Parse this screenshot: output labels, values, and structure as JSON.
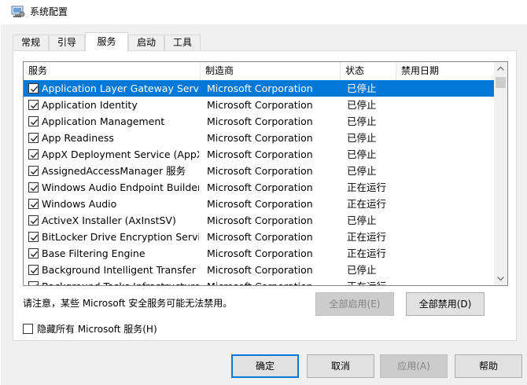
{
  "window": {
    "title": "系统配置",
    "icon": "msconfig-icon"
  },
  "tabs": [
    {
      "label": "常规",
      "active": false
    },
    {
      "label": "引导",
      "active": false
    },
    {
      "label": "服务",
      "active": true
    },
    {
      "label": "启动",
      "active": false
    },
    {
      "label": "工具",
      "active": false
    }
  ],
  "services": {
    "columns": [
      "服务",
      "制造商",
      "状态",
      "禁用日期"
    ],
    "rows": [
      {
        "name": "Application Layer Gateway Service",
        "vendor": "Microsoft Corporation",
        "status": "已停止",
        "date": "",
        "checked": true,
        "selected": true
      },
      {
        "name": "Application Identity",
        "vendor": "Microsoft Corporation",
        "status": "已停止",
        "date": "",
        "checked": true
      },
      {
        "name": "Application Management",
        "vendor": "Microsoft Corporation",
        "status": "已停止",
        "date": "",
        "checked": true
      },
      {
        "name": "App Readiness",
        "vendor": "Microsoft Corporation",
        "status": "已停止",
        "date": "",
        "checked": true
      },
      {
        "name": "AppX Deployment Service (AppX...",
        "vendor": "Microsoft Corporation",
        "status": "已停止",
        "date": "",
        "checked": true
      },
      {
        "name": "AssignedAccessManager 服务",
        "vendor": "Microsoft Corporation",
        "status": "已停止",
        "date": "",
        "checked": true
      },
      {
        "name": "Windows Audio Endpoint Builder",
        "vendor": "Microsoft Corporation",
        "status": "正在运行",
        "date": "",
        "checked": true
      },
      {
        "name": "Windows Audio",
        "vendor": "Microsoft Corporation",
        "status": "正在运行",
        "date": "",
        "checked": true
      },
      {
        "name": "ActiveX Installer (AxInstSV)",
        "vendor": "Microsoft Corporation",
        "status": "已停止",
        "date": "",
        "checked": true
      },
      {
        "name": "BitLocker Drive Encryption Service",
        "vendor": "Microsoft Corporation",
        "status": "正在运行",
        "date": "",
        "checked": true
      },
      {
        "name": "Base Filtering Engine",
        "vendor": "Microsoft Corporation",
        "status": "正在运行",
        "date": "",
        "checked": true
      },
      {
        "name": "Background Intelligent Transfer ...",
        "vendor": "Microsoft Corporation",
        "status": "已停止",
        "date": "",
        "checked": true
      },
      {
        "name": "Background Tasks Infrastructure ...",
        "vendor": "Microsoft Corporation",
        "status": "正在运行",
        "date": "",
        "checked": true
      }
    ]
  },
  "note": "请注意，某些 Microsoft 安全服务可能无法禁用。",
  "buttons": {
    "enable_all": "全部启用(E)",
    "disable_all": "全部禁用(D)",
    "ok": "确定",
    "cancel": "取消",
    "apply": "应用(A)",
    "help": "帮助"
  },
  "hide_ms": {
    "label": "隐藏所有 Microsoft 服务(H)",
    "checked": false
  },
  "colors": {
    "selection": "#0078d7",
    "dialog_bg": "#f0f0f0",
    "button_bg": "#e1e1e1",
    "disabled_text": "#838383"
  }
}
